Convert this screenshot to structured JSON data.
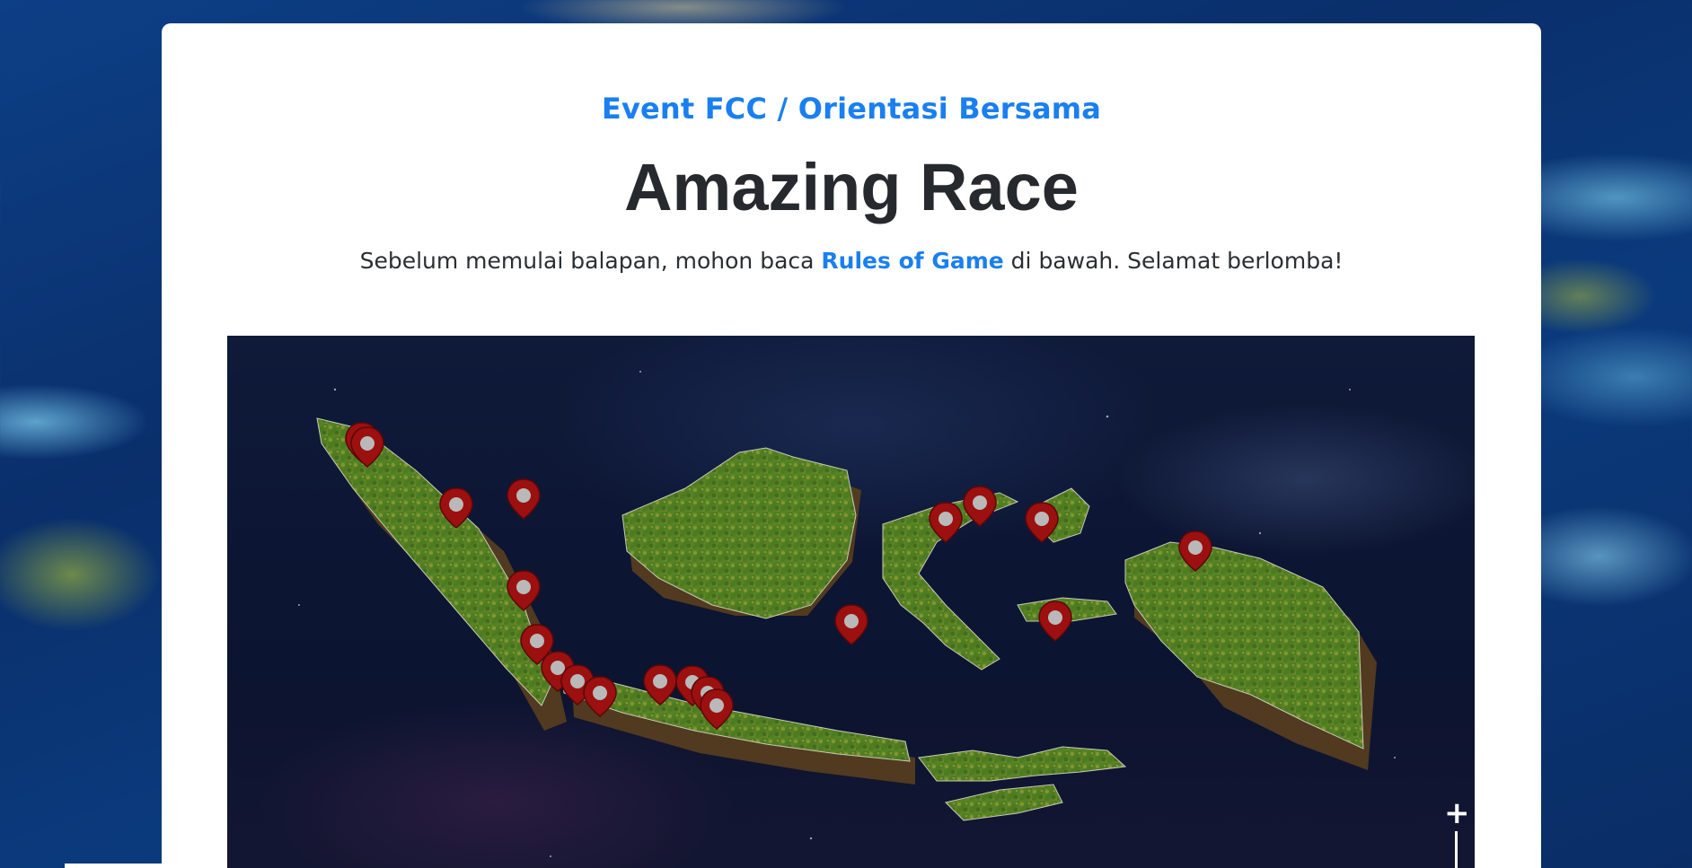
{
  "header": {
    "breadcrumb": "Event FCC / Orientasi Bersama",
    "title": "Amazing Race"
  },
  "intro": {
    "text_before": "Sebelum memulai balapan, mohon baca ",
    "rules_link": "Rules of Game",
    "text_after": " di bawah. Selamat berlomba!"
  },
  "map": {
    "zoom_in_label": "+",
    "marker_count": 19,
    "colors": {
      "marker": "#9c1010",
      "land": "#4e7d21",
      "sea": "#0f1a3a"
    }
  },
  "colors": {
    "accent": "#1a7ff0",
    "heading": "#262a2e",
    "card": "#ffffff"
  }
}
